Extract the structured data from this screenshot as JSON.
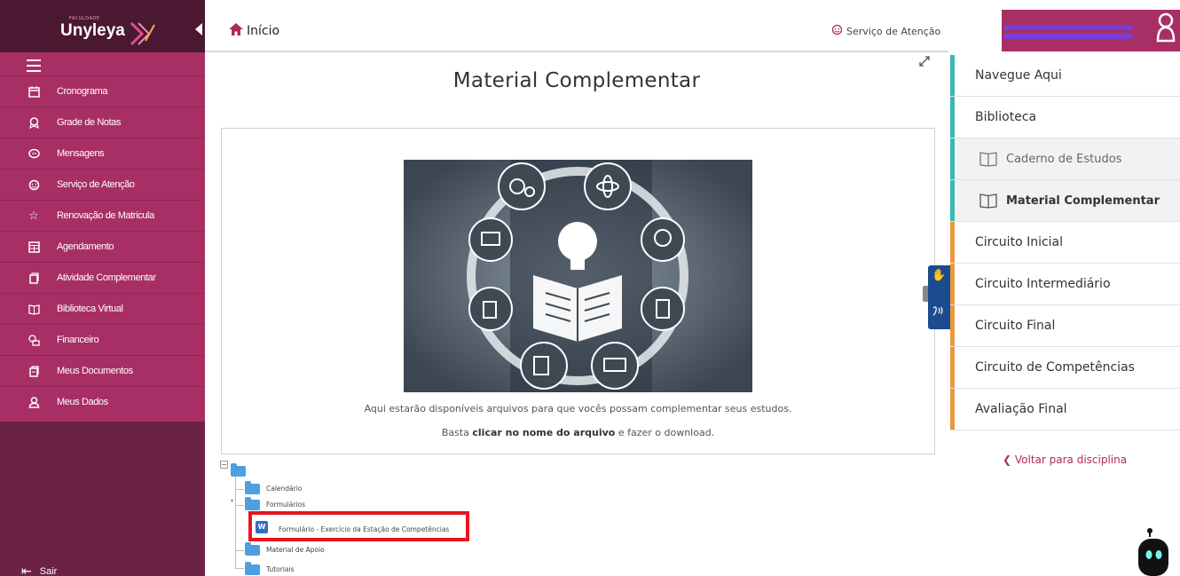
{
  "sidebar": {
    "logo_small": "FACULDADE",
    "logo_text": "Unyleya",
    "items": [
      {
        "label": "Cronograma",
        "icon": "calendar-icon"
      },
      {
        "label": "Grade de Notas",
        "icon": "award-icon"
      },
      {
        "label": "Mensagens",
        "icon": "chat-icon"
      },
      {
        "label": "Serviço de Atenção",
        "icon": "support-chat-icon"
      },
      {
        "label": "Renovação de Matricula",
        "icon": "star-icon"
      },
      {
        "label": "Agendamento",
        "icon": "calendar-grid-icon"
      },
      {
        "label": "Atividade Complementar",
        "icon": "document-icon"
      },
      {
        "label": "Biblioteca Virtual",
        "icon": "book-icon"
      },
      {
        "label": "Financeiro",
        "icon": "money-icon"
      },
      {
        "label": "Meus Documentos",
        "icon": "documents-icon"
      },
      {
        "label": "Meus Dados",
        "icon": "user-icon"
      }
    ],
    "logout_label": "Sair"
  },
  "header": {
    "home_label": "Início",
    "service_label": "Serviço de Atenção"
  },
  "main": {
    "title": "Material Complementar",
    "description_line1": "Aqui estarão disponíveis arquivos para que vocês possam complementar seus estudos.",
    "description_line2_prefix": "Basta ",
    "description_line2_bold": "clicar no nome do arquivo",
    "description_line2_suffix": " e fazer o download."
  },
  "tree": {
    "folders": [
      {
        "label": "Calendário"
      },
      {
        "label": "Formulários"
      },
      {
        "label": "Material de Apoio"
      },
      {
        "label": "Tutoriais"
      }
    ],
    "file_label": "Formulário - Exercício da Estação de Competências",
    "file_icon_letter": "W"
  },
  "right_panel": {
    "items": [
      {
        "label": "Navegue Aqui"
      },
      {
        "label": "Biblioteca"
      },
      {
        "label": "Caderno de Estudos"
      },
      {
        "label": "Material Complementar"
      },
      {
        "label": "Circuito Inicial"
      },
      {
        "label": "Circuito Intermediário"
      },
      {
        "label": "Circuito Final"
      },
      {
        "label": "Circuito de Competências"
      },
      {
        "label": "Avaliação Final"
      }
    ],
    "back_label": "Voltar para disciplina"
  },
  "colors": {
    "brand_dark": "#6b2345",
    "brand": "#a82f65",
    "teal": "#3ab7b5",
    "orange": "#e89a3c",
    "highlight_red": "#e8151f"
  }
}
